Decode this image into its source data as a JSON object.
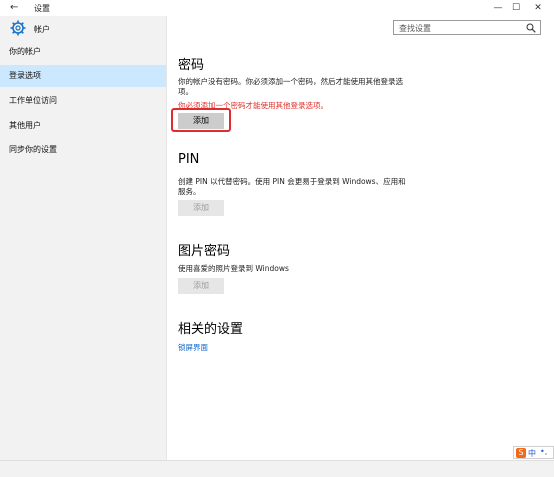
{
  "window": {
    "back_icon": "←",
    "title": "设置",
    "minimize": "—",
    "maximize": "☐",
    "close": "✕"
  },
  "sidebar": {
    "header": "帐户",
    "items": [
      {
        "label": "你的帐户",
        "selected": false
      },
      {
        "label": "登录选项",
        "selected": true
      },
      {
        "label": "工作单位访问",
        "selected": false
      },
      {
        "label": "其他用户",
        "selected": false
      },
      {
        "label": "同步你的设置",
        "selected": false
      }
    ]
  },
  "search": {
    "placeholder": "查找设置"
  },
  "password": {
    "heading": "密码",
    "description": "你的帐户没有密码。你必须添加一个密码，然后才能使用其他登录选项。",
    "warning": "你必须添加一个密码才能使用其他登录选项。",
    "button": "添加"
  },
  "pin": {
    "heading": "PIN",
    "description": "创建 PIN 以代替密码。使用 PIN 会更易于登录到 Windows、应用和服务。",
    "button": "添加"
  },
  "picture_password": {
    "heading": "图片密码",
    "description": "使用喜爱的照片登录到 Windows",
    "button": "添加"
  },
  "related": {
    "heading": "相关的设置",
    "link": "锁屏界面"
  },
  "ime": {
    "logo": "S",
    "text": "中",
    "dot": "•,"
  },
  "colors": {
    "selected": "#cce8ff",
    "link": "#0a64c8",
    "warning": "#e0302a",
    "highlight_box": "#e02c2c"
  }
}
